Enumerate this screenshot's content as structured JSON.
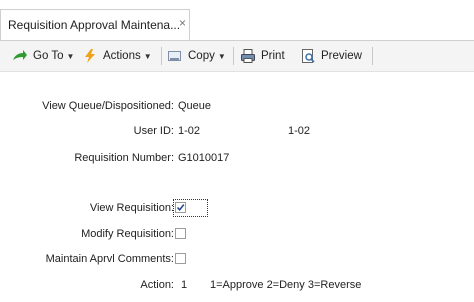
{
  "tab": {
    "title": "Requisition Approval Maintena...",
    "close": "×"
  },
  "toolbar": {
    "goto_label": "Go To",
    "actions_label": "Actions",
    "copy_label": "Copy",
    "print_label": "Print",
    "preview_label": "Preview"
  },
  "form": {
    "view_queue": {
      "label": "View Queue/Dispositioned:",
      "value": "Queue"
    },
    "user_id": {
      "label": "User ID:",
      "value": "1-02",
      "value2": "1-02"
    },
    "req_number": {
      "label": "Requisition Number:",
      "value": "G1010017"
    },
    "view_req": {
      "label": "View Requisition:",
      "checked": true
    },
    "modify_req": {
      "label": "Modify Requisition:",
      "checked": false
    },
    "maintain_comments": {
      "label": "Maintain Aprvl Comments:",
      "checked": false
    },
    "action": {
      "label": "Action:",
      "value": "1",
      "legend": "1=Approve 2=Deny 3=Reverse"
    }
  }
}
